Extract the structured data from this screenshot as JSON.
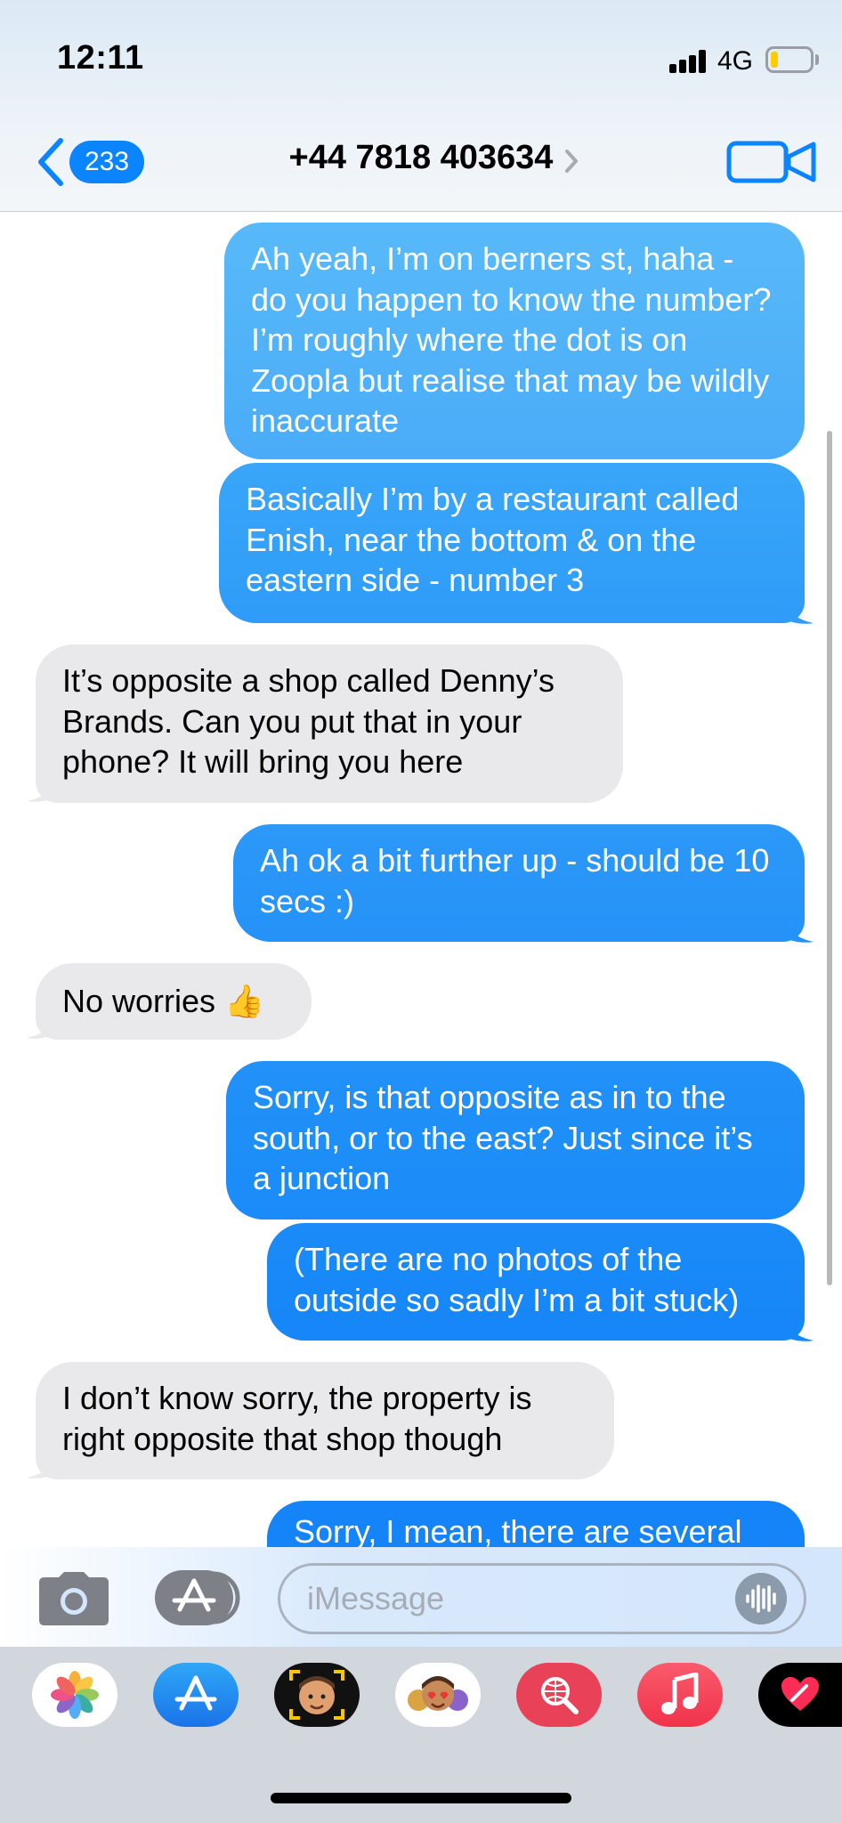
{
  "status_bar": {
    "time": "12:11",
    "network": "4G"
  },
  "nav": {
    "back_count": "233",
    "contact": "+44 7818 403634"
  },
  "messages": [
    {
      "direction": "out",
      "text": "Ah yeah, I’m on berners st, haha - do you happen to know the number? I’m roughly where the dot is on Zoopla but realise that may be wildly inaccurate"
    },
    {
      "direction": "out",
      "text": "Basically I’m by a restaurant called Enish, near the bottom & on the eastern side - number 3"
    },
    {
      "direction": "in",
      "text": "It’s opposite a shop called Denny’s Brands. Can you put that in your phone? It will bring you here"
    },
    {
      "direction": "out",
      "text": "Ah ok a bit further up - should be 10 secs :)"
    },
    {
      "direction": "in",
      "text": "No worries 👍"
    },
    {
      "direction": "out",
      "text": "Sorry, is that opposite as in to the south, or to the east? Just since it’s a junction"
    },
    {
      "direction": "out",
      "text": "(There are no photos of the outside so sadly I’m a bit stuck)"
    },
    {
      "direction": "in",
      "text": "I don’t know sorry, the property is right opposite that shop though"
    },
    {
      "direction": "out",
      "text": "Sorry, I mean, there are several"
    }
  ],
  "composer": {
    "placeholder": "iMessage"
  },
  "app_drawer": [
    {
      "icon": "photos-app-icon"
    },
    {
      "icon": "app-store-icon"
    },
    {
      "icon": "memoji-camera-icon"
    },
    {
      "icon": "memoji-stickers-icon"
    },
    {
      "icon": "web-search-icon"
    },
    {
      "icon": "music-icon"
    },
    {
      "icon": "digital-touch-icon"
    }
  ],
  "colors": {
    "bubble_out_top": "#5ab8f8",
    "bubble_out_bottom": "#1a86f8",
    "bubble_in": "#e9e9eb",
    "accent": "#0a84ff"
  }
}
